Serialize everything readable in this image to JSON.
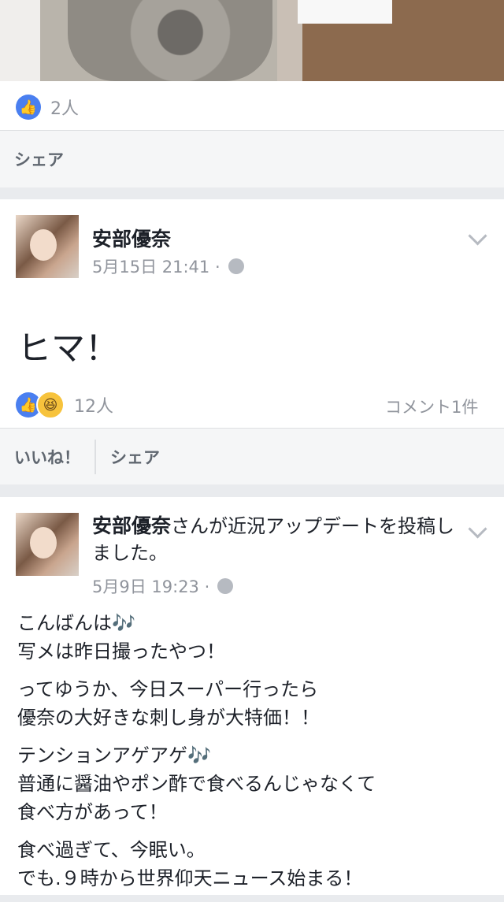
{
  "post0": {
    "reaction_count": "2人",
    "share_label": "シェア"
  },
  "post1": {
    "author": "安部優奈",
    "date": "5月15日 21:41 ·",
    "content": "ヒマ！",
    "reaction_count": "12人",
    "comment_count": "コメント1件",
    "like_label": "いいね！",
    "share_label": "シェア"
  },
  "post2": {
    "author": "安部優奈",
    "headline_suffix": "さんが近況アップデートを投稿しました。",
    "date": "5月9日 19:23 ·",
    "paragraphs": [
      [
        "こんばんは🎶",
        "写メは昨日撮ったやつ！"
      ],
      [
        "ってゆうか、今日スーパー行ったら",
        "優奈の大好きな刺し身が大特価！！"
      ],
      [
        "テンションアゲアゲ🎶",
        "普通に醤油やポン酢で食べるんじゃなくて",
        "食べ方があって！"
      ],
      [
        "食べ過ぎて、今眠い。",
        "でも.９時から世界仰天ニュース始まる！"
      ]
    ]
  },
  "icons": {
    "like": "like-icon",
    "haha": "haha-icon",
    "globe": "globe-icon",
    "chevron": "chevron-down-icon"
  },
  "colors": {
    "like_blue": "#4a7ff0",
    "haha_yellow": "#f7c33c",
    "meta_gray": "#90949c",
    "feed_bg": "#e9ebee"
  }
}
